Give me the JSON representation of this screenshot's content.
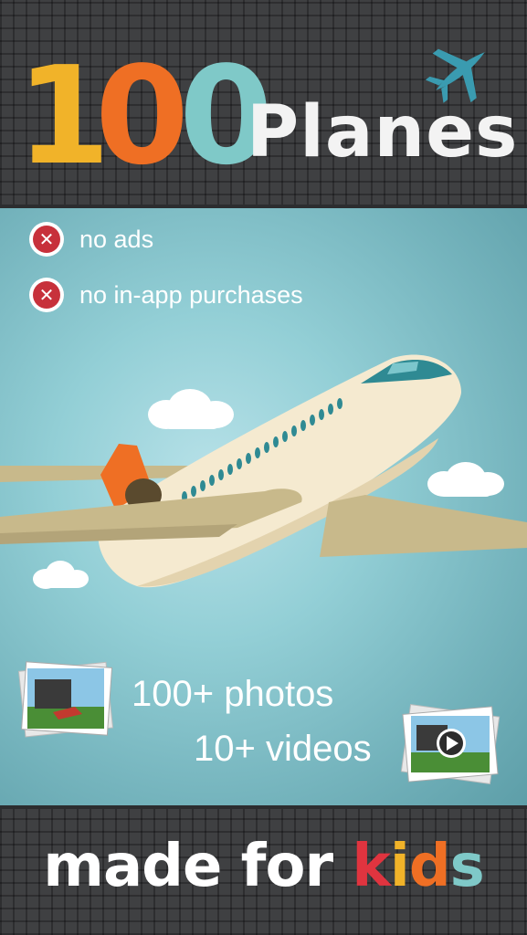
{
  "header": {
    "title_digits": [
      "1",
      "0",
      "0"
    ],
    "title_word": "Planes",
    "logo_icon": "airplane-icon",
    "colors": {
      "one": "#f1b329",
      "zero1": "#ef6f24",
      "zero2": "#7fc9c8",
      "logo": "#3a9bb0"
    }
  },
  "features": [
    {
      "icon": "x-circle-icon",
      "label": "no ads"
    },
    {
      "icon": "x-circle-icon",
      "label": "no in-app purchases"
    }
  ],
  "media": {
    "photos": "100+ photos",
    "videos": "10+ videos",
    "photos_icon": "photo-stack-icon",
    "videos_icon": "video-stack-icon"
  },
  "footer": {
    "prefix": "made for ",
    "kids_letters": [
      "k",
      "i",
      "d",
      "s"
    ]
  }
}
